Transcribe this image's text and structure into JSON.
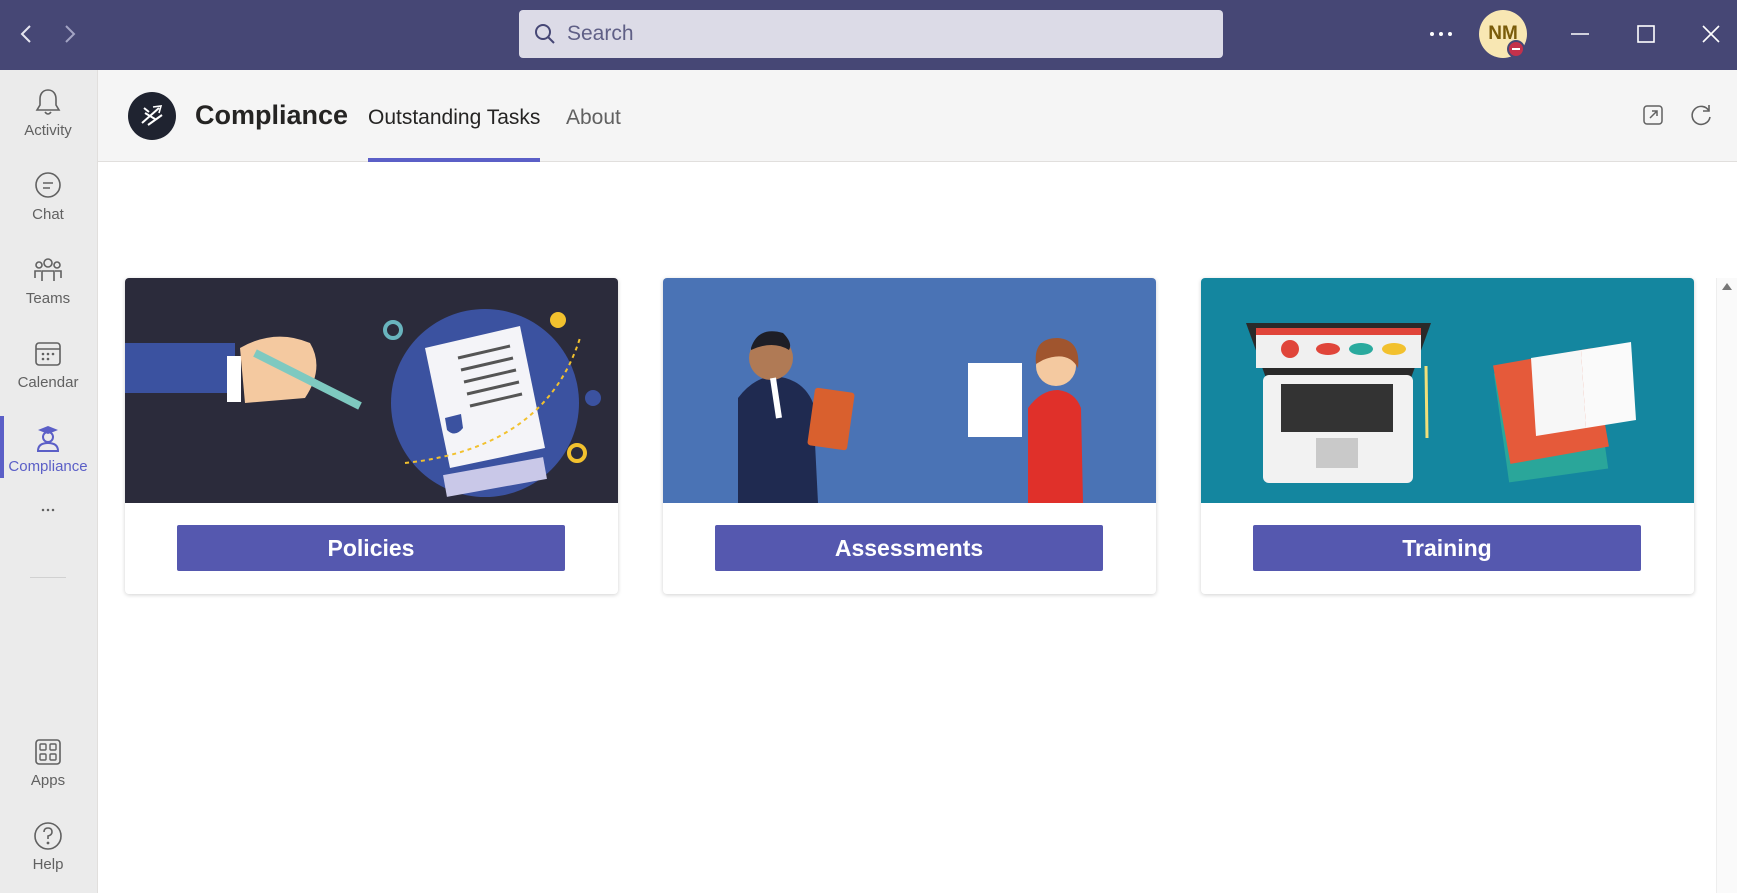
{
  "titlebar": {
    "search_placeholder": "Search",
    "more_label": "...",
    "avatar_initials": "NM",
    "presence_status": "busy",
    "bg_color": "#464775"
  },
  "rail": {
    "items": [
      {
        "label": "Activity",
        "icon": "bell-icon"
      },
      {
        "label": "Chat",
        "icon": "chat-icon"
      },
      {
        "label": "Teams",
        "icon": "teams-icon"
      },
      {
        "label": "Calendar",
        "icon": "calendar-icon"
      },
      {
        "label": "Compliance",
        "icon": "compliance-icon",
        "active": true
      },
      {
        "label": "Apps",
        "icon": "apps-icon"
      },
      {
        "label": "Help",
        "icon": "help-icon"
      }
    ],
    "more_label": "..."
  },
  "app": {
    "title": "Compliance",
    "tabs": [
      {
        "label": "Outstanding Tasks",
        "active": true
      },
      {
        "label": "About"
      }
    ],
    "accent": "#5b5fc7"
  },
  "cards": [
    {
      "button_label": "Policies",
      "image": "policy-signing-illustration",
      "bg": "#2b2b3b"
    },
    {
      "button_label": "Assessments",
      "image": "assessment-people-illustration",
      "bg": "#4a73b5"
    },
    {
      "button_label": "Training",
      "image": "training-laptop-illustration",
      "bg": "#14869f"
    }
  ]
}
